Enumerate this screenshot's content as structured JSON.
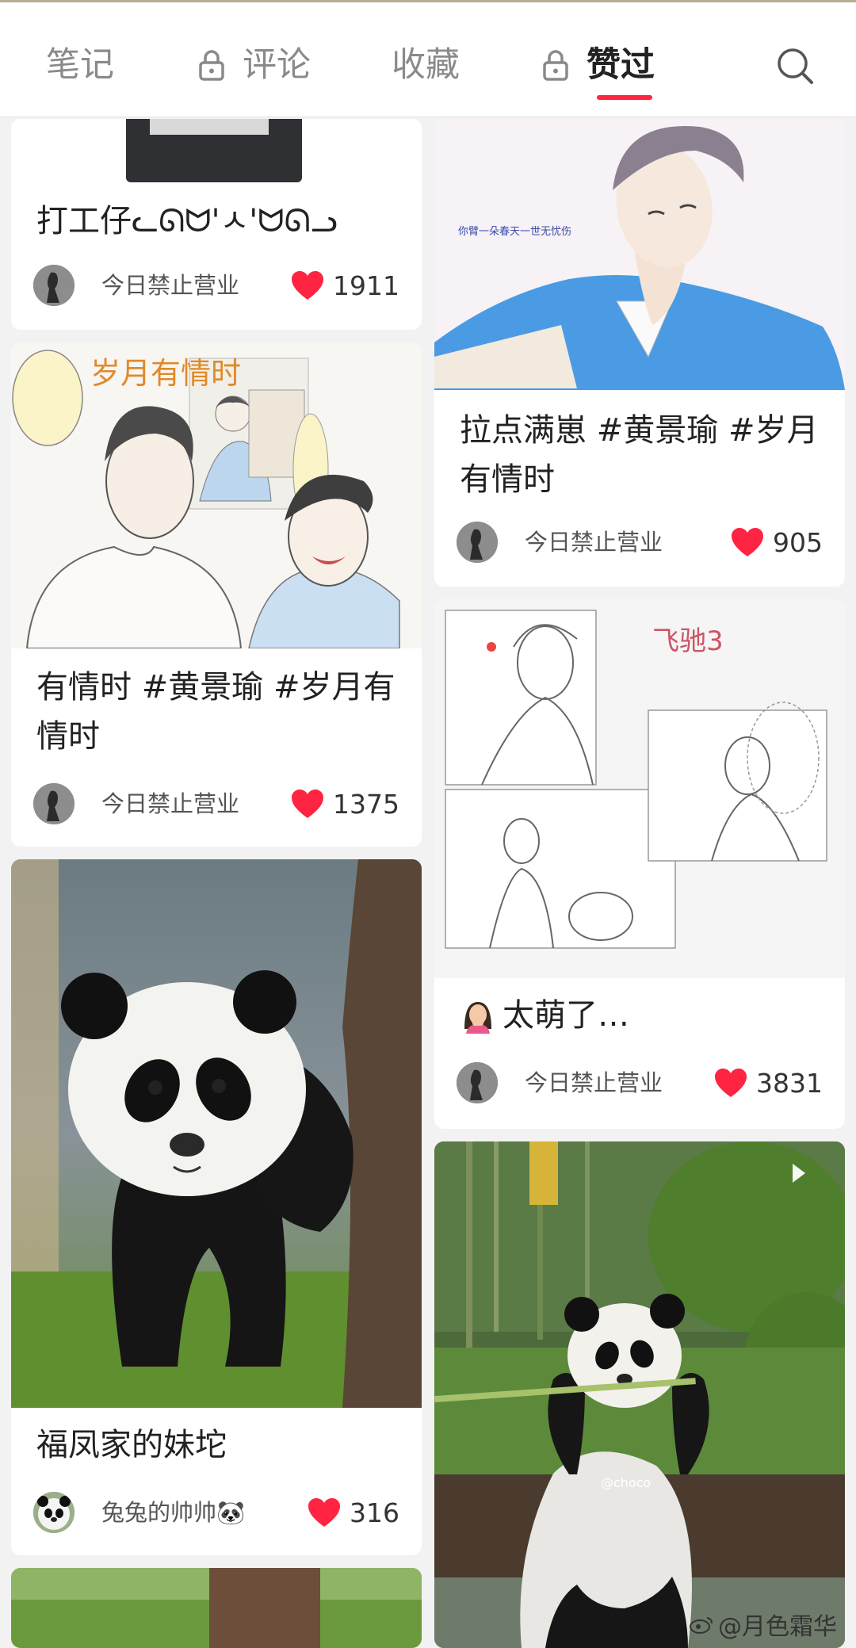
{
  "tabs": [
    {
      "label": "笔记",
      "locked": false,
      "active": false
    },
    {
      "label": "评论",
      "locked": true,
      "active": false
    },
    {
      "label": "收藏",
      "locked": false,
      "active": false
    },
    {
      "label": "赞过",
      "locked": true,
      "active": true
    }
  ],
  "accent_color": "#ff2442",
  "cards": {
    "c1": {
      "title": "打工仔ᓚᘏᗢ'ㅅ'ᗢᘏᓗ",
      "author": "今日禁止营业",
      "likes": "1911"
    },
    "c2": {
      "title": "拉点满崽 #黄景瑜 #岁月有情时",
      "author": "今日禁止营业",
      "likes": "905",
      "image_caption": "你臂一朵春天一世无忧伤"
    },
    "c3": {
      "title": "有情时 #黄景瑜 #岁月有情时",
      "author": "今日禁止营业",
      "likes": "1375",
      "image_heading": "岁月有情时"
    },
    "c4": {
      "title": "太萌了…",
      "author": "今日禁止营业",
      "likes": "3831",
      "image_heading": "飞驰3"
    },
    "c5": {
      "title": "福凤家的妹坨",
      "author": "兔兔的帅帅🐼",
      "likes": "316"
    },
    "c6": {
      "image_tag": "@choco"
    }
  },
  "watermark": "@月色霜华"
}
